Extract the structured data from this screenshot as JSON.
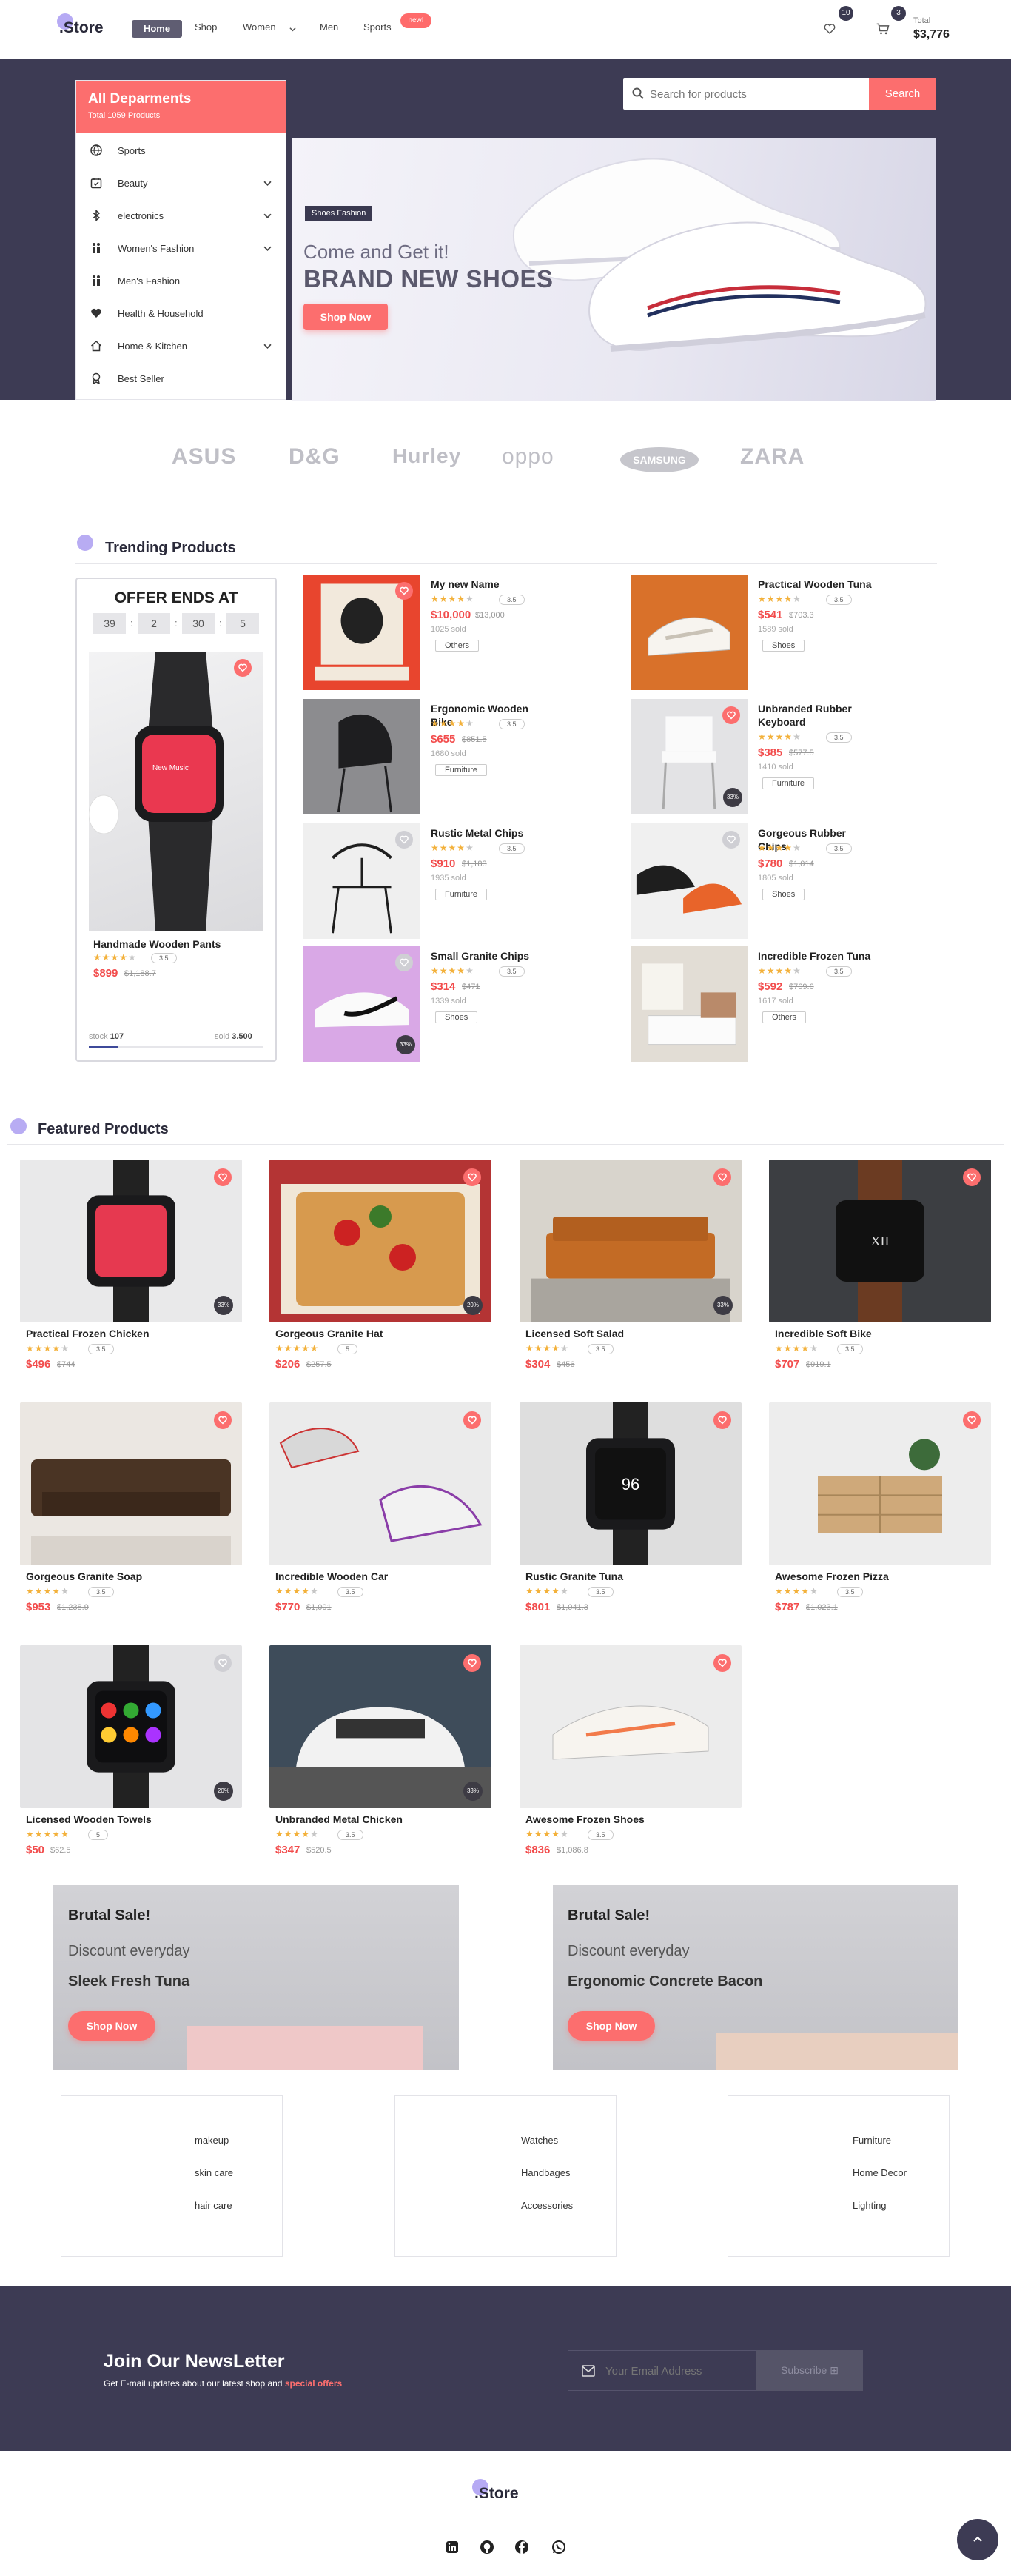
{
  "header": {
    "logo": ".Store",
    "nav": [
      "Home",
      "Shop",
      "Women",
      "Men",
      "Sports"
    ],
    "new_badge": "new!",
    "wishlist_count": "10",
    "cart_count": "3",
    "total_label": "Total",
    "total_value": "$3,776"
  },
  "sidebar": {
    "title": "All Deparments",
    "subtitle": "Total 1059 Products",
    "items": [
      {
        "label": "Sports",
        "icon": "ball-icon",
        "expandable": false
      },
      {
        "label": "Beauty",
        "icon": "calendar-icon",
        "expandable": true
      },
      {
        "label": "electronics",
        "icon": "bluetooth-icon",
        "expandable": true
      },
      {
        "label": "Women's Fashion",
        "icon": "people-icon",
        "expandable": true
      },
      {
        "label": "Men's Fashion",
        "icon": "people-icon",
        "expandable": false
      },
      {
        "label": "Health & Household",
        "icon": "heart-icon",
        "expandable": false
      },
      {
        "label": "Home & Kitchen",
        "icon": "home-icon",
        "expandable": true
      },
      {
        "label": "Best Seller",
        "icon": "badge-icon",
        "expandable": false
      }
    ]
  },
  "search": {
    "placeholder": "Search for products",
    "button": "Search"
  },
  "banner": {
    "tag": "Shoes Fashion",
    "subtitle": "Come and Get it!",
    "title": "BRAND NEW SHOES",
    "button": "Shop Now"
  },
  "brands": [
    "ASUS",
    "D&G",
    "Hurley",
    "oppo",
    "SAMSUNG",
    "ZARA"
  ],
  "trending": {
    "heading": "Trending Products",
    "offer": {
      "title": "OFFER ENDS AT",
      "timer": [
        "39",
        "2",
        "30",
        "5"
      ],
      "product": "Handmade Wooden Pants",
      "rating": 3.5,
      "price": "$899",
      "old_price": "$1,188.7",
      "stock_label": "stock",
      "stock": "107",
      "sold_label": "sold",
      "sold": "3.500",
      "progress": 0.17
    },
    "products": [
      {
        "title": "My new Name",
        "rating": 3.5,
        "price": "$10,000",
        "old": "$13,000",
        "sold": "1025 sold",
        "tag": "Others",
        "img": "poster"
      },
      {
        "title": "Practical Wooden Tuna",
        "rating": 3.5,
        "price": "$541",
        "old": "$703.3",
        "sold": "1589 sold",
        "tag": "Shoes",
        "img": "sneaker-orange"
      },
      {
        "title": "Ergonomic Wooden Bike",
        "rating": 3.5,
        "price": "$655",
        "old": "$851.5",
        "sold": "1680 sold",
        "tag": "Furniture",
        "img": "chair-black"
      },
      {
        "title": "Unbranded Rubber Keyboard",
        "rating": 3.5,
        "price": "$385",
        "old": "$577.5",
        "sold": "1410 sold",
        "tag": "Furniture",
        "img": "chair-white"
      },
      {
        "title": "Rustic Metal Chips",
        "rating": 3.5,
        "price": "$910",
        "old": "$1,183",
        "sold": "1935 sold",
        "tag": "Furniture",
        "img": "chair-wood"
      },
      {
        "title": "Gorgeous Rubber Chips",
        "rating": 3.5,
        "price": "$780",
        "old": "$1,014",
        "sold": "1805 sold",
        "tag": "Shoes",
        "img": "shoes-jordan"
      },
      {
        "title": "Small Granite Chips",
        "rating": 3.5,
        "price": "$314",
        "old": "$471",
        "sold": "1339 sold",
        "tag": "Shoes",
        "img": "nike-purple"
      },
      {
        "title": "Incredible Frozen Tuna",
        "rating": 3.5,
        "price": "$592",
        "old": "$769.6",
        "sold": "1617 sold",
        "tag": "Others",
        "img": "bedroom"
      }
    ]
  },
  "featured": {
    "heading": "Featured Products",
    "products": [
      {
        "title": "Practical Frozen Chicken",
        "rating": 3.5,
        "price": "$496",
        "old": "$744",
        "disc": "33%",
        "img": "watch-white",
        "heart": true
      },
      {
        "title": "Gorgeous Granite Hat",
        "rating": 5,
        "price": "$206",
        "old": "$257.5",
        "disc": "20%",
        "img": "pizza",
        "heart": true
      },
      {
        "title": "Licensed Soft Salad",
        "rating": 3.5,
        "price": "$304",
        "old": "$456",
        "disc": "33%",
        "img": "sofa",
        "heart": true
      },
      {
        "title": "Incredible Soft Bike",
        "rating": 3.5,
        "price": "$707",
        "old": "$919.1",
        "disc": "",
        "img": "watch-dark",
        "heart": true
      },
      {
        "title": "Gorgeous Granite Soap",
        "rating": 3.5,
        "price": "$953",
        "old": "$1,238.9",
        "disc": "",
        "img": "chesterfield",
        "heart": true
      },
      {
        "title": "Incredible Wooden Car",
        "rating": 3.5,
        "price": "$770",
        "old": "$1,001",
        "disc": "",
        "img": "sneakers-fly",
        "heart": true
      },
      {
        "title": "Rustic Granite Tuna",
        "rating": 3.5,
        "price": "$801",
        "old": "$1,041.3",
        "disc": "",
        "img": "watch-gray",
        "heart": true
      },
      {
        "title": "Awesome Frozen Pizza",
        "rating": 3.5,
        "price": "$787",
        "old": "$1,023.1",
        "disc": "",
        "img": "dresser",
        "heart": true
      },
      {
        "title": "Licensed Wooden Towels",
        "rating": 5,
        "price": "$50",
        "old": "$62.5",
        "disc": "20%",
        "img": "watch-apps",
        "heart": false
      },
      {
        "title": "Unbranded Metal Chicken",
        "rating": 3.5,
        "price": "$347",
        "old": "$520.5",
        "disc": "33%",
        "img": "car",
        "heart": true
      },
      {
        "title": "Awesome Frozen Shoes",
        "rating": 3.5,
        "price": "$836",
        "old": "$1,086.8",
        "disc": "",
        "img": "shoe-single",
        "heart": true
      }
    ]
  },
  "sales": [
    {
      "heading": "Brutal Sale!",
      "sub": "Discount everyday",
      "name": "Sleek Fresh Tuna",
      "button": "Shop Now"
    },
    {
      "heading": "Brutal Sale!",
      "sub": "Discount everyday",
      "name": "Ergonomic Concrete Bacon",
      "button": "Shop Now"
    }
  ],
  "link_boxes": [
    [
      "makeup",
      "skin care",
      "hair care"
    ],
    [
      "Watches",
      "Handbages",
      "Accessories"
    ],
    [
      "Furniture",
      "Home Decor",
      "Lighting"
    ]
  ],
  "newsletter": {
    "title": "Join Our NewsLetter",
    "desc": "Get E-mail updates about our latest shop and ",
    "desc_highlight": "special offers",
    "placeholder": "Your Email Address",
    "button": "Subscribe"
  },
  "footer": {
    "logo": ".Store",
    "social": [
      "linkedin-icon",
      "github-icon",
      "facebook-icon",
      "whatsapp-icon"
    ]
  },
  "colors": {
    "accent": "#fc6e6e",
    "dark": "#3d3b54",
    "star": "#f3b13b",
    "price": "#f24c4c",
    "lavender": "#b8acf3"
  }
}
